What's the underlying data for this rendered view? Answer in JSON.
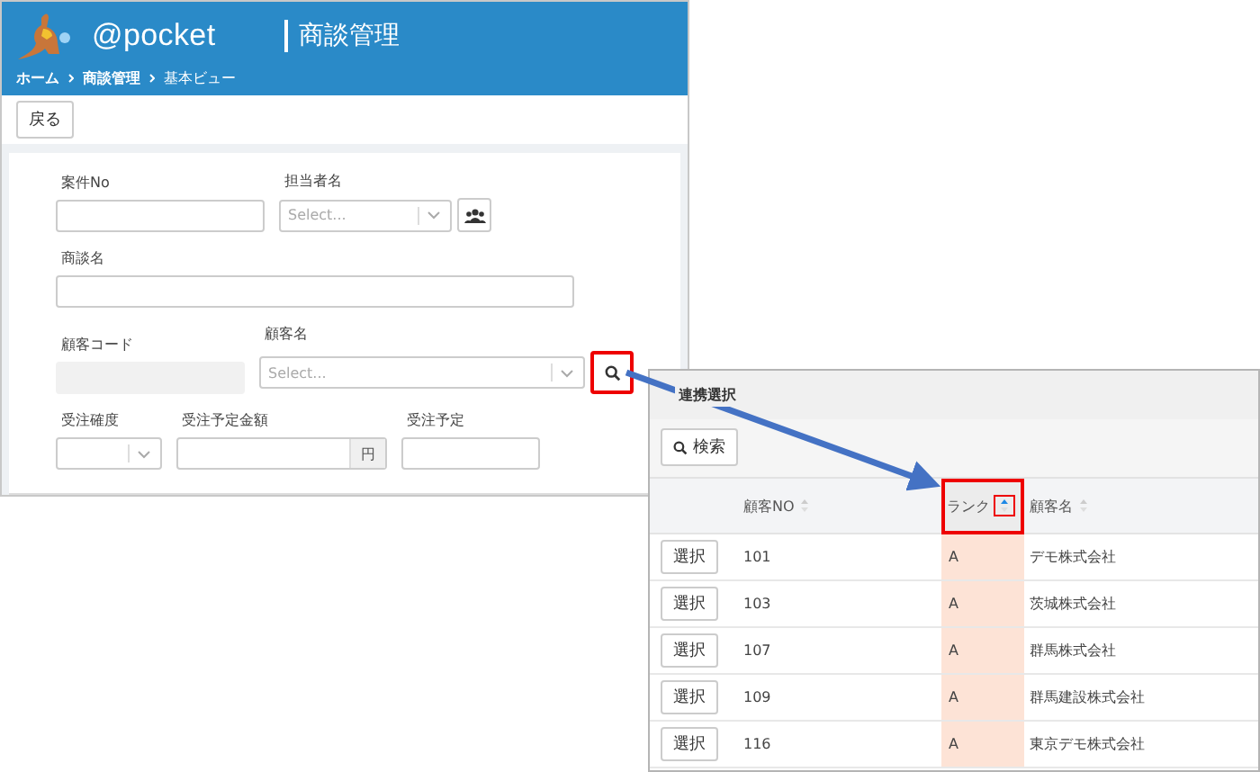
{
  "app": {
    "logo": "@pocket",
    "title": "商談管理",
    "breadcrumb": [
      "ホーム",
      "商談管理",
      "基本ビュー"
    ]
  },
  "toolbar": {
    "back_button": "戻る"
  },
  "form": {
    "rows": [
      [
        {
          "kind": "text",
          "label": "案件No"
        },
        {
          "kind": "select",
          "label": "担当者名",
          "placeholder": "Select...",
          "people_button": true
        }
      ],
      [
        {
          "kind": "text",
          "label": "商談名"
        }
      ],
      [
        {
          "kind": "readonly",
          "label": "顧客コード"
        },
        {
          "kind": "select",
          "label": "顧客名",
          "placeholder": "Select...",
          "search_button": true,
          "search_highlighted": true
        }
      ],
      [
        {
          "kind": "select",
          "label": "受注確度"
        },
        {
          "kind": "currency",
          "label": "受注予定金額",
          "suffix": "円"
        },
        {
          "kind": "text",
          "label": "受注予定"
        }
      ]
    ]
  },
  "popup": {
    "title": "連携選択",
    "search_button": "検索",
    "columns": [
      {
        "label": "顧客NO",
        "sorted_ascending": false,
        "highlighted": false
      },
      {
        "label": "ランク",
        "sorted_ascending": true,
        "highlighted": true
      },
      {
        "label": "顧客名",
        "sorted_ascending": false,
        "highlighted": false
      }
    ],
    "rows": [
      {
        "button": "選択",
        "cells": [
          "101",
          "A",
          "デモ株式会社"
        ]
      },
      {
        "button": "選択",
        "cells": [
          "103",
          "A",
          "茨城株式会社"
        ]
      },
      {
        "button": "選択",
        "cells": [
          "107",
          "A",
          "群馬株式会社"
        ]
      },
      {
        "button": "選択",
        "cells": [
          "109",
          "A",
          "群馬建設株式会社"
        ]
      },
      {
        "button": "選択",
        "cells": [
          "116",
          "A",
          "東京デモ株式会社"
        ]
      }
    ]
  }
}
